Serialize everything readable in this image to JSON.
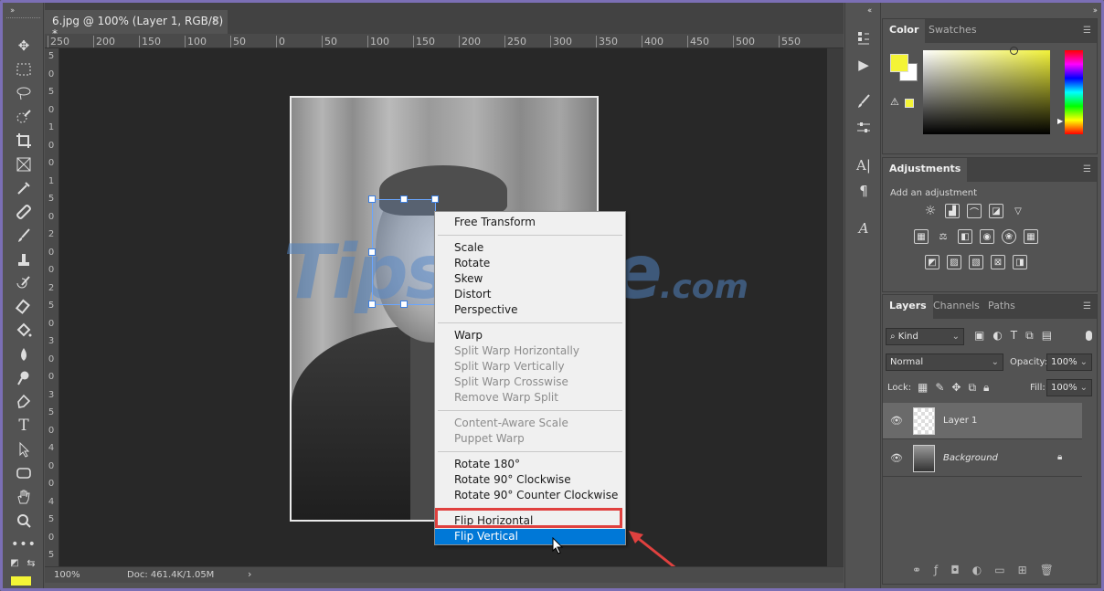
{
  "document": {
    "tab_title": "6.jpg @ 100% (Layer 1, RGB/8) *",
    "close_glyph": "×"
  },
  "ruler_top": [
    "250",
    "200",
    "150",
    "100",
    "50",
    "0",
    "50",
    "100",
    "150",
    "200",
    "250",
    "300",
    "350",
    "400",
    "450",
    "500",
    "550"
  ],
  "ruler_left": [
    "5",
    "0",
    "5",
    "0",
    "1",
    "0",
    "0",
    "1",
    "5",
    "0",
    "2",
    "0",
    "0",
    "2",
    "5",
    "0",
    "3",
    "0",
    "0",
    "3",
    "5",
    "0",
    "4",
    "0",
    "0",
    "4",
    "5",
    "0",
    "5"
  ],
  "watermark": {
    "text": "TipsMake",
    "suffix": ".com"
  },
  "context_menu": {
    "items": [
      {
        "label": "Free Transform",
        "enabled": true
      },
      {
        "label": "Scale",
        "enabled": true
      },
      {
        "label": "Rotate",
        "enabled": true
      },
      {
        "label": "Skew",
        "enabled": true
      },
      {
        "label": "Distort",
        "enabled": true
      },
      {
        "label": "Perspective",
        "enabled": true
      },
      {
        "label": "Warp",
        "enabled": true
      },
      {
        "label": "Split Warp Horizontally",
        "enabled": false
      },
      {
        "label": "Split Warp Vertically",
        "enabled": false
      },
      {
        "label": "Split Warp Crosswise",
        "enabled": false
      },
      {
        "label": "Remove Warp Split",
        "enabled": false
      },
      {
        "label": "Content-Aware Scale",
        "enabled": false
      },
      {
        "label": "Puppet Warp",
        "enabled": false
      },
      {
        "label": "Rotate 180°",
        "enabled": true
      },
      {
        "label": "Rotate 90° Clockwise",
        "enabled": true
      },
      {
        "label": "Rotate 90° Counter Clockwise",
        "enabled": true
      },
      {
        "label": "Flip Horizontal",
        "enabled": true,
        "annotated": true
      },
      {
        "label": "Flip Vertical",
        "enabled": true,
        "highlighted": true
      }
    ]
  },
  "status": {
    "zoom": "100%",
    "doc_info": "Doc: 461.4K/1.05M",
    "arrow": "›"
  },
  "color_panel": {
    "tabs": [
      "Color",
      "Swatches"
    ],
    "foreground": "#f4f436",
    "background": "#ffffff"
  },
  "adjustments_panel": {
    "tab": "Adjustments",
    "hint": "Add an adjustment"
  },
  "layers_panel": {
    "tabs": [
      "Layers",
      "Channels",
      "Paths"
    ],
    "filter_kind": "Kind",
    "blend_mode": "Normal",
    "opacity_label": "Opacity:",
    "opacity_value": "100%",
    "lock_label": "Lock:",
    "fill_label": "Fill:",
    "fill_value": "100%",
    "layers": [
      {
        "name": "Layer 1",
        "selected": true
      },
      {
        "name": "Background",
        "selected": false,
        "locked": true
      }
    ]
  },
  "colors": {
    "accent": "#0078d7",
    "annotation": "#e0413f",
    "frame": "#7b6fb5"
  }
}
